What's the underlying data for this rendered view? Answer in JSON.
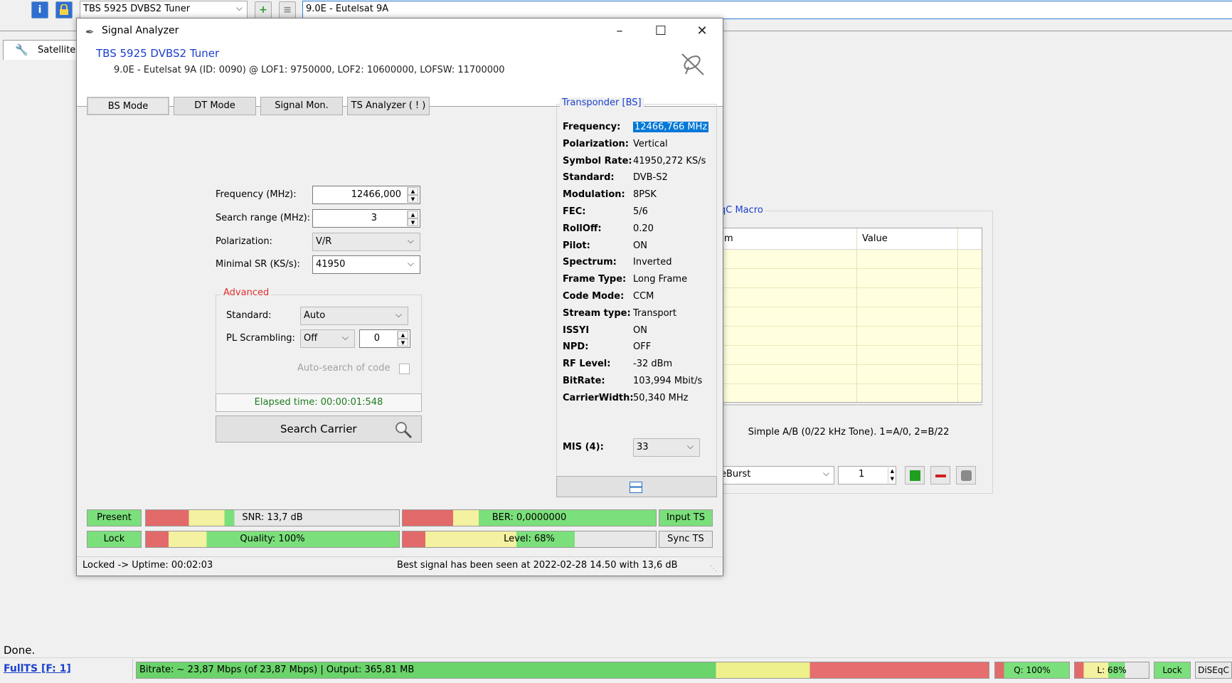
{
  "app": {
    "tuner_combo": "TBS 5925 DVBS2 Tuner",
    "satellite_field": "9.0E - Eutelsat 9A",
    "tab_satellite": "Satellite",
    "diseqc": {
      "legend": "qC Macro",
      "col_name": "m",
      "col_value": "Value",
      "description": "Simple A/B (0/22 kHz Tone). 1=A/0, 2=B/22",
      "burst_value": "eBurst",
      "count_value": "1"
    },
    "status_done": "Done.",
    "statusbar": {
      "fullts": "FullTS [F: 1]",
      "bitrate": "Bitrate: ~ 23,87 Mbps (of 23,87 Mbps) | Output: 365,81 MB",
      "quality": "Q: 100%",
      "level": "L: 68%",
      "lock": "Lock",
      "diseqc": "DiSEqC"
    }
  },
  "dialog": {
    "title": "Signal Analyzer",
    "tuner_title": "TBS 5925 DVBS2 Tuner",
    "tuner_info": "9.0E - Eutelsat 9A (ID: 0090) @ LOF1: 9750000, LOF2: 10600000, LOFSW: 11700000",
    "mode_buttons": [
      "BS Mode",
      "DT Mode",
      "Signal Mon.",
      "TS Analyzer ( ! )"
    ],
    "form": {
      "frequency_label": "Frequency (MHz):",
      "frequency_value": "12466,000",
      "search_range_label": "Search range (MHz):",
      "search_range_value": "3",
      "polarization_label": "Polarization:",
      "polarization_value": "V/R",
      "min_sr_label": "Minimal SR (KS/s):",
      "min_sr_value": "41950"
    },
    "advanced": {
      "legend": "Advanced",
      "standard_label": "Standard:",
      "standard_value": "Auto",
      "pl_label": "PL Scrambling:",
      "pl_mode": "Off",
      "pl_value": "0",
      "autosearch_label": "Auto-search of code"
    },
    "elapsed": "Elapsed time: 00:00:01:548",
    "search_button": "Search Carrier",
    "transponder": {
      "legend": "Transponder [BS]",
      "rows": [
        {
          "k": "Frequency:",
          "v": "12466,766 MHz"
        },
        {
          "k": "Polarization:",
          "v": "Vertical"
        },
        {
          "k": "Symbol Rate:",
          "v": "41950,272 KS/s"
        },
        {
          "k": "Standard:",
          "v": "DVB-S2"
        },
        {
          "k": "Modulation:",
          "v": "8PSK"
        },
        {
          "k": "FEC:",
          "v": "5/6"
        },
        {
          "k": "RollOff:",
          "v": "0.20"
        },
        {
          "k": "Pilot:",
          "v": "ON"
        },
        {
          "k": "Spectrum:",
          "v": "Inverted"
        },
        {
          "k": "Frame Type:",
          "v": "Long Frame"
        },
        {
          "k": "Code Mode:",
          "v": "CCM"
        },
        {
          "k": "Stream type:",
          "v": "Transport"
        },
        {
          "k": "ISSYI",
          "v": "ON"
        },
        {
          "k": "NPD:",
          "v": "OFF"
        },
        {
          "k": "RF Level:",
          "v": "-32 dBm"
        },
        {
          "k": "BitRate:",
          "v": "103,994 Mbit/s"
        },
        {
          "k": "CarrierWidth:",
          "v": "50,340 MHz"
        }
      ],
      "mis_label": "MIS (4):",
      "mis_value": "33"
    },
    "indicators": {
      "present": "Present",
      "lock": "Lock",
      "snr": "SNR: 13,7 dB",
      "ber": "BER: 0,0000000",
      "quality": "Quality: 100%",
      "level": "Level: 68%",
      "input_ts": "Input TS",
      "sync_ts": "Sync TS",
      "quality_pct": 100,
      "level_pct": 68
    },
    "status_left": "Locked -> Uptime: 00:02:03",
    "status_right": "Best signal has been seen at 2022-02-28 14.50 with 13,6 dB"
  }
}
